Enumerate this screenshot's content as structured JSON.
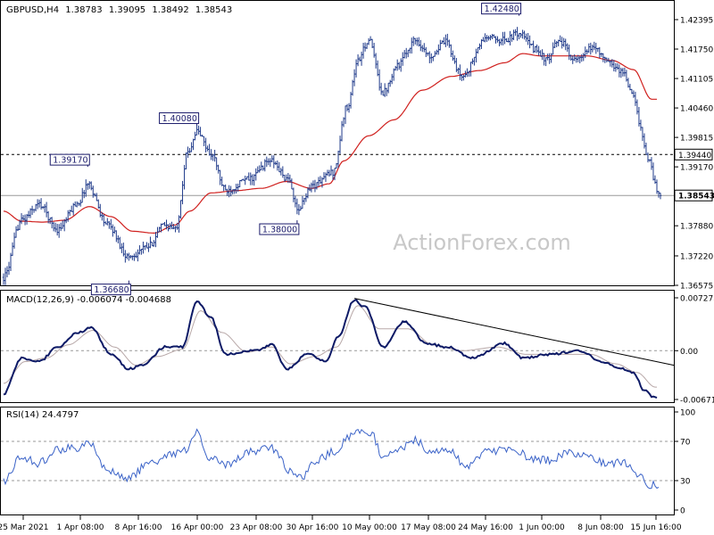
{
  "header": {
    "symbol": "GBPUSD,H4",
    "open": "1.38783",
    "high": "1.39095",
    "low": "1.38492",
    "close": "1.38543"
  },
  "watermark": "ActionForex.com",
  "colors": {
    "bars": "#1f3a8a",
    "ma": "#d0201e",
    "macd": "#0d1a66",
    "signal": "#b8a8a8",
    "rsi": "#3b63c8",
    "frame": "#000000",
    "watermark": "#c8c8c8"
  },
  "chart_data": [
    {
      "type": "ohlc",
      "panel": "price",
      "y_ticks": [
        "1.42395",
        "1.41750",
        "1.41105",
        "1.40460",
        "1.39815",
        "1.39170",
        "1.38525",
        "1.37880",
        "1.37220",
        "1.36575"
      ],
      "ylim": [
        1.36575,
        1.42395
      ],
      "current_price_label": "1.38543",
      "level_label": "1.39440",
      "annotations": [
        "1.42480",
        "1.40080",
        "1.39170",
        "1.38000",
        "1.36680"
      ],
      "x_labels": [
        "25 Mar 2021",
        "1 Apr 08:00",
        "8 Apr 16:00",
        "16 Apr 00:00",
        "23 Apr 08:00",
        "30 Apr 16:00",
        "10 May 00:00",
        "17 May 08:00",
        "24 May 16:00",
        "1 Jun 00:00",
        "8 Jun 08:00",
        "15 Jun 16:00"
      ],
      "close_anchors": [
        [
          0,
          1.3675
        ],
        [
          10,
          1.38
        ],
        [
          20,
          1.3835
        ],
        [
          30,
          1.378
        ],
        [
          42,
          1.384
        ],
        [
          47,
          1.388
        ],
        [
          58,
          1.379
        ],
        [
          70,
          1.372
        ],
        [
          80,
          1.374
        ],
        [
          90,
          1.379
        ],
        [
          96,
          1.378
        ],
        [
          103,
          1.395
        ],
        [
          108,
          1.3995
        ],
        [
          116,
          1.3945
        ],
        [
          124,
          1.3865
        ],
        [
          137,
          1.389
        ],
        [
          149,
          1.393
        ],
        [
          160,
          1.3885
        ],
        [
          164,
          1.382
        ],
        [
          172,
          1.3875
        ],
        [
          184,
          1.3905
        ],
        [
          192,
          1.405
        ],
        [
          198,
          1.415
        ],
        [
          204,
          1.4195
        ],
        [
          212,
          1.408
        ],
        [
          220,
          1.414
        ],
        [
          230,
          1.4195
        ],
        [
          238,
          1.416
        ],
        [
          247,
          1.419
        ],
        [
          256,
          1.4115
        ],
        [
          270,
          1.42
        ],
        [
          280,
          1.4195
        ],
        [
          288,
          1.421
        ],
        [
          297,
          1.4175
        ],
        [
          304,
          1.415
        ],
        [
          310,
          1.4195
        ],
        [
          320,
          1.415
        ],
        [
          330,
          1.418
        ],
        [
          338,
          1.4145
        ],
        [
          346,
          1.4125
        ],
        [
          352,
          1.407
        ],
        [
          356,
          1.4
        ],
        [
          360,
          1.3935
        ],
        [
          366,
          1.3857
        ]
      ],
      "ma_anchors": [
        [
          0,
          1.382
        ],
        [
          10,
          1.3798
        ],
        [
          22,
          1.3796
        ],
        [
          34,
          1.38
        ],
        [
          48,
          1.383
        ],
        [
          60,
          1.3808
        ],
        [
          72,
          1.3776
        ],
        [
          84,
          1.3772
        ],
        [
          96,
          1.379
        ],
        [
          104,
          1.382
        ],
        [
          116,
          1.386
        ],
        [
          130,
          1.3865
        ],
        [
          144,
          1.387
        ],
        [
          158,
          1.3885
        ],
        [
          172,
          1.387
        ],
        [
          182,
          1.388
        ],
        [
          190,
          1.393
        ],
        [
          204,
          1.3985
        ],
        [
          218,
          1.402
        ],
        [
          234,
          1.4085
        ],
        [
          250,
          1.4115
        ],
        [
          266,
          1.4128
        ],
        [
          280,
          1.4145
        ],
        [
          290,
          1.4165
        ],
        [
          300,
          1.416
        ],
        [
          312,
          1.416
        ],
        [
          326,
          1.416
        ],
        [
          340,
          1.415
        ],
        [
          352,
          1.413
        ],
        [
          362,
          1.4065
        ]
      ]
    },
    {
      "type": "line",
      "panel": "macd",
      "label": "MACD(12,26,9) -0.006074 -0.004688",
      "y_ticks": [
        "0.007275",
        "0.00",
        "-0.00671"
      ],
      "ylim": [
        -0.00671,
        0.007275
      ],
      "macd_anchors": [
        [
          0,
          -0.006
        ],
        [
          10,
          -0.001
        ],
        [
          20,
          -0.0015
        ],
        [
          30,
          0.0005
        ],
        [
          42,
          0.0025
        ],
        [
          49,
          0.0032
        ],
        [
          60,
          -0.0005
        ],
        [
          70,
          -0.0025
        ],
        [
          78,
          -0.002
        ],
        [
          90,
          0.0005
        ],
        [
          100,
          0.0005
        ],
        [
          108,
          0.0068
        ],
        [
          116,
          0.0045
        ],
        [
          124,
          -0.0005
        ],
        [
          140,
          0.0
        ],
        [
          150,
          0.0008
        ],
        [
          158,
          -0.0025
        ],
        [
          170,
          -0.0005
        ],
        [
          180,
          -0.0015
        ],
        [
          187,
          0.002
        ],
        [
          196,
          0.007
        ],
        [
          202,
          0.006
        ],
        [
          212,
          0.0005
        ],
        [
          224,
          0.004
        ],
        [
          236,
          0.001
        ],
        [
          248,
          0.0005
        ],
        [
          262,
          -0.001
        ],
        [
          280,
          0.001
        ],
        [
          290,
          -0.001
        ],
        [
          305,
          -0.0005
        ],
        [
          322,
          0.0
        ],
        [
          334,
          -0.0015
        ],
        [
          346,
          -0.0025
        ],
        [
          352,
          -0.003
        ],
        [
          358,
          -0.0055
        ],
        [
          364,
          -0.0065
        ]
      ],
      "signal_anchors": [
        [
          0,
          -0.0045
        ],
        [
          12,
          -0.0015
        ],
        [
          24,
          -0.001
        ],
        [
          36,
          0.0008
        ],
        [
          50,
          0.0028
        ],
        [
          62,
          0.0005
        ],
        [
          74,
          -0.002
        ],
        [
          86,
          -0.0008
        ],
        [
          100,
          0.0002
        ],
        [
          110,
          0.0055
        ],
        [
          122,
          0.0025
        ],
        [
          136,
          -0.0002
        ],
        [
          150,
          0.0005
        ],
        [
          160,
          -0.0018
        ],
        [
          174,
          -0.0008
        ],
        [
          186,
          0.0005
        ],
        [
          198,
          0.0062
        ],
        [
          210,
          0.003
        ],
        [
          226,
          0.003
        ],
        [
          240,
          0.0008
        ],
        [
          256,
          0.0
        ],
        [
          276,
          0.0005
        ],
        [
          292,
          -0.0005
        ],
        [
          310,
          -0.0005
        ],
        [
          328,
          -0.0005
        ],
        [
          342,
          -0.0018
        ],
        [
          354,
          -0.003
        ],
        [
          364,
          -0.005
        ]
      ]
    },
    {
      "type": "line",
      "panel": "rsi",
      "label": "RSI(14) 24.4797",
      "y_ticks": [
        "100",
        "70",
        "30",
        "0"
      ],
      "ylim": [
        0,
        100
      ],
      "rsi_anchors": [
        [
          0,
          28
        ],
        [
          10,
          55
        ],
        [
          20,
          48
        ],
        [
          30,
          62
        ],
        [
          42,
          64
        ],
        [
          48,
          70
        ],
        [
          58,
          40
        ],
        [
          70,
          33
        ],
        [
          80,
          45
        ],
        [
          92,
          57
        ],
        [
          102,
          60
        ],
        [
          108,
          78
        ],
        [
          116,
          52
        ],
        [
          124,
          45
        ],
        [
          138,
          60
        ],
        [
          150,
          63
        ],
        [
          160,
          40
        ],
        [
          166,
          32
        ],
        [
          174,
          50
        ],
        [
          186,
          60
        ],
        [
          192,
          75
        ],
        [
          198,
          82
        ],
        [
          206,
          76
        ],
        [
          212,
          52
        ],
        [
          220,
          60
        ],
        [
          230,
          72
        ],
        [
          238,
          60
        ],
        [
          248,
          62
        ],
        [
          258,
          45
        ],
        [
          272,
          60
        ],
        [
          284,
          63
        ],
        [
          296,
          52
        ],
        [
          306,
          50
        ],
        [
          316,
          60
        ],
        [
          328,
          54
        ],
        [
          338,
          47
        ],
        [
          348,
          48
        ],
        [
          354,
          34
        ],
        [
          362,
          26
        ],
        [
          366,
          24
        ]
      ]
    }
  ]
}
